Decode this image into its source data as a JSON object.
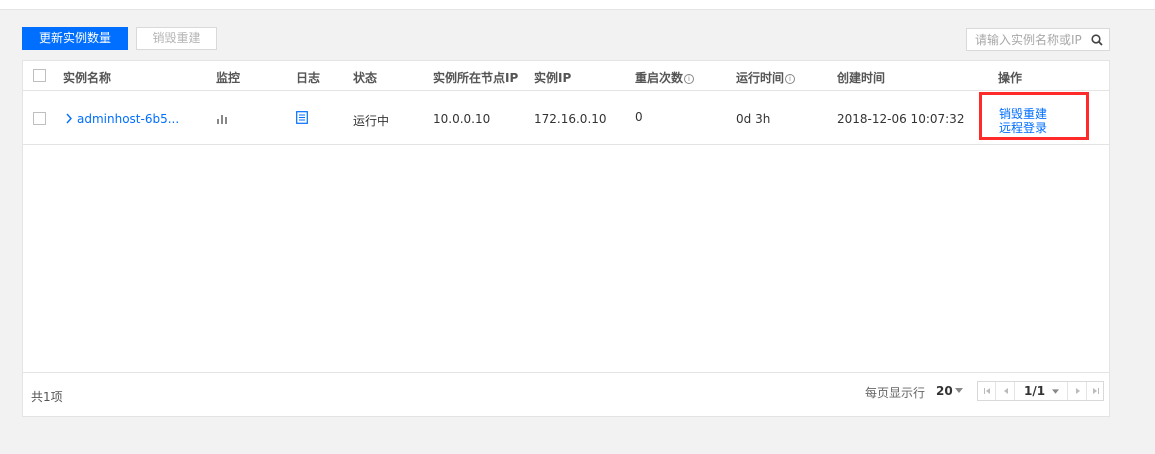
{
  "toolbar": {
    "update_count_button": "更新实例数量",
    "destroy_rebuild_button": "销毁重建",
    "search_placeholder": "请输入实例名称或IP"
  },
  "table": {
    "headers": {
      "name": "实例名称",
      "monitor": "监控",
      "log": "日志",
      "status": "状态",
      "node_ip": "实例所在节点IP",
      "instance_ip": "实例IP",
      "restart_count": "重启次数",
      "run_time": "运行时间",
      "created_at": "创建时间",
      "actions": "操作"
    },
    "rows": [
      {
        "name": "adminhost-6b5...",
        "status": "运行中",
        "node_ip": "10.0.0.10",
        "instance_ip": "172.16.0.10",
        "restart_count": "0",
        "run_time": "0d 3h",
        "created_at": "2018-12-06 10:07:32",
        "action_destroy": "销毁重建",
        "action_login": "远程登录"
      }
    ]
  },
  "footer": {
    "total": "共1项",
    "page_size_label": "每页显示行",
    "page_size": "20",
    "page_current": "1/1"
  },
  "colors": {
    "primary": "#006eff",
    "running": "#0abf5b",
    "highlight": "#ff2a2a"
  }
}
